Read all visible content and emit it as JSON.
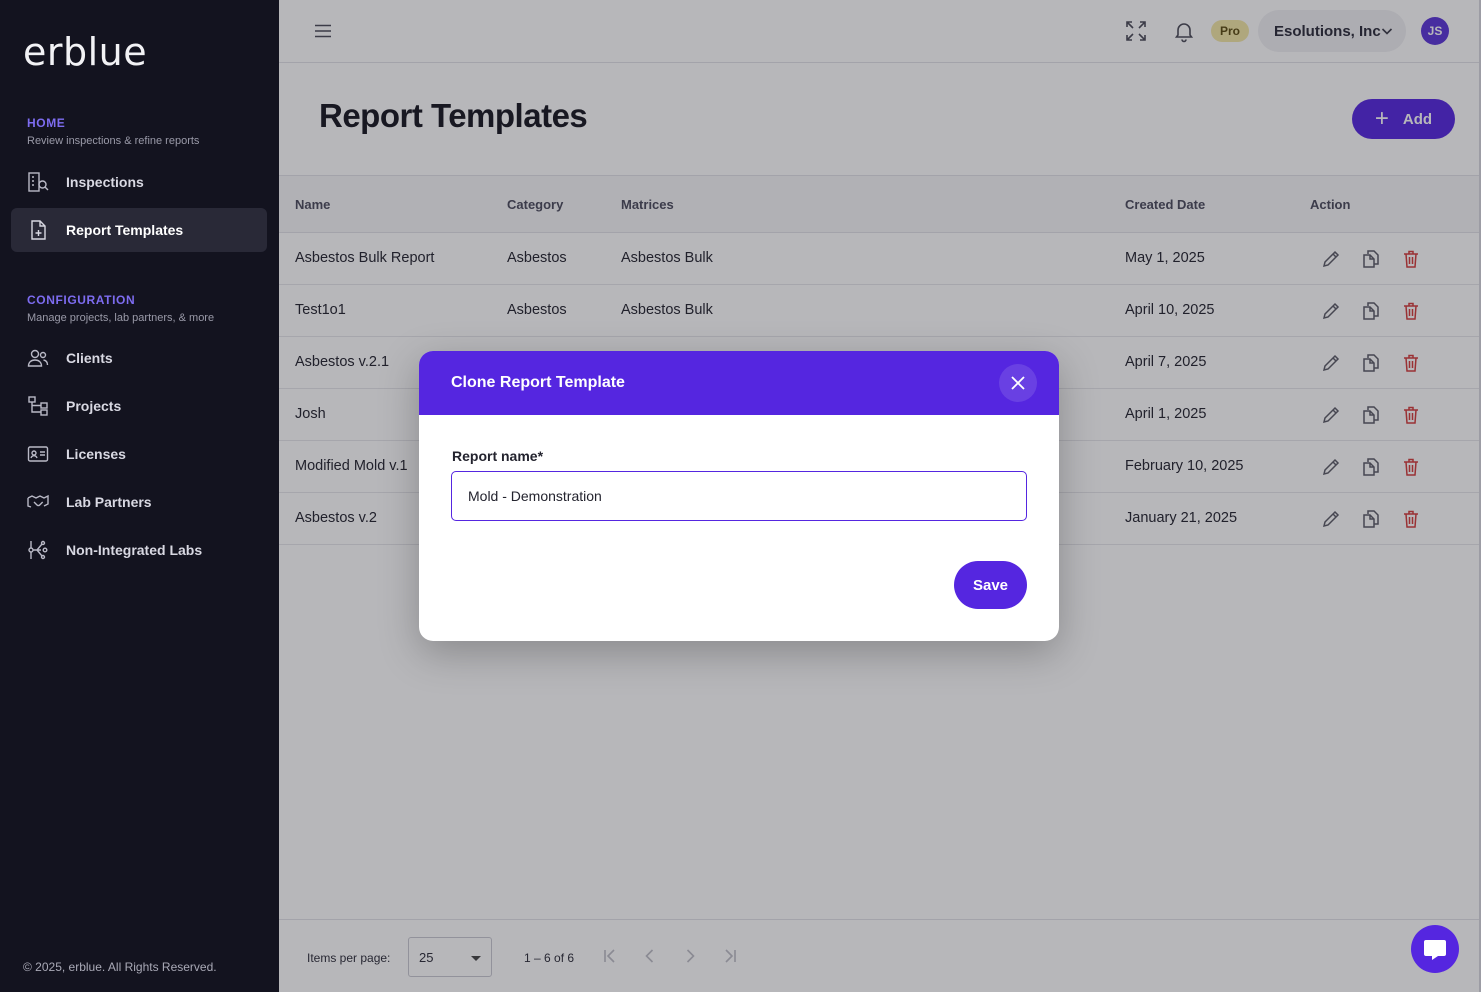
{
  "brand": {
    "logo_text": "erblue",
    "accent": "#5526e0"
  },
  "sidebar": {
    "sections": [
      {
        "title": "HOME",
        "subtitle": "Review inspections & refine reports"
      },
      {
        "title": "CONFIGURATION",
        "subtitle": "Manage projects, lab partners, & more"
      }
    ],
    "items": [
      {
        "label": "Inspections",
        "icon": "building-search-icon"
      },
      {
        "label": "Report Templates",
        "icon": "document-add-icon",
        "active": true
      },
      {
        "label": "Clients",
        "icon": "users-icon"
      },
      {
        "label": "Projects",
        "icon": "hierarchy-icon"
      },
      {
        "label": "Licenses",
        "icon": "id-card-icon"
      },
      {
        "label": "Lab Partners",
        "icon": "handshake-icon"
      },
      {
        "label": "Non-Integrated Labs",
        "icon": "branch-icon"
      }
    ],
    "footer": "© 2025, erblue. All Rights Reserved."
  },
  "topbar": {
    "badge": "Pro",
    "organization": "Esolutions, Inc",
    "avatar_initials": "JS"
  },
  "page": {
    "title": "Report Templates",
    "add_label": "Add"
  },
  "table": {
    "headers": [
      "Name",
      "Category",
      "Matrices",
      "Created Date",
      "Action"
    ],
    "rows": [
      {
        "name": "Asbestos Bulk Report",
        "category": "Asbestos",
        "matrices": "Asbestos Bulk",
        "created": "May 1, 2025"
      },
      {
        "name": "Test1o1",
        "category": "Asbestos",
        "matrices": "Asbestos Bulk",
        "created": "April 10, 2025"
      },
      {
        "name": "Asbestos v.2.1",
        "category": "",
        "matrices": "",
        "created": "April 7, 2025"
      },
      {
        "name": "Josh",
        "category": "",
        "matrices": "",
        "created": "April 1, 2025"
      },
      {
        "name": "Modified Mold v.1",
        "category": "",
        "matrices": "",
        "created": "February 10, 2025"
      },
      {
        "name": "Asbestos v.2",
        "category": "",
        "matrices": "",
        "created": "January 21, 2025"
      }
    ]
  },
  "pagination": {
    "items_per_page_label": "Items per page:",
    "items_per_page_value": "25",
    "range": "1 – 6 of 6"
  },
  "modal": {
    "title": "Clone Report Template",
    "field_label": "Report name*",
    "field_value": "Mold - Demonstration",
    "save_label": "Save"
  }
}
